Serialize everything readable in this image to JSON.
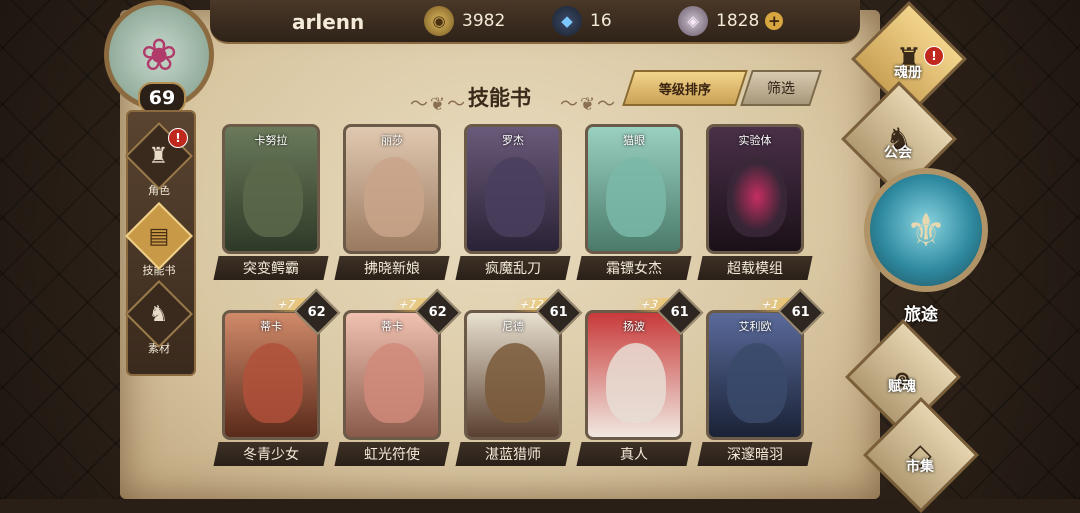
{
  "player": {
    "name": "arlenn",
    "level": "69"
  },
  "resources": [
    {
      "icon": "gold-coin-icon",
      "value": "3982"
    },
    {
      "icon": "blue-crystal-icon",
      "value": "16"
    },
    {
      "icon": "pink-diamond-icon",
      "value": "1828"
    }
  ],
  "header": {
    "title": "技能书",
    "sort_label": "等级排序",
    "filter_label": "筛选"
  },
  "left_nav": [
    {
      "label": "角色",
      "icon": "helmet-icon",
      "alert": "!"
    },
    {
      "label": "技能书",
      "icon": "book-icon"
    },
    {
      "label": "素材",
      "icon": "beast-icon"
    }
  ],
  "right_nav": {
    "soul_book": {
      "label": "魂册",
      "alert": "!"
    },
    "guild": {
      "label": "公会"
    },
    "journey": {
      "label": "旅途"
    },
    "talent": {
      "label": "赋魂"
    },
    "market": {
      "label": "市集"
    }
  },
  "cards_row1": [
    {
      "hero": "卡努拉",
      "skill": "突变鳄霸",
      "color": "#5a6a4a"
    },
    {
      "hero": "丽莎",
      "skill": "拂晓新娘",
      "color": "#c9a58a"
    },
    {
      "hero": "罗杰",
      "skill": "疯魔乱刀",
      "color": "#4a3e5e"
    },
    {
      "hero": "猫眼",
      "skill": "霜镖女杰",
      "color": "#7ab8a8"
    },
    {
      "hero": "实验体",
      "skill": "超载模组",
      "color": "#3a2838"
    }
  ],
  "cards_row2": [
    {
      "hero": "蒂卡",
      "skill": "冬青少女",
      "bonus": "+7",
      "level": "62",
      "color": "#b0503a"
    },
    {
      "hero": "蒂卡",
      "skill": "虹光符使",
      "bonus": "+7",
      "level": "62",
      "color": "#d08a7a"
    },
    {
      "hero": "尼德",
      "skill": "湛蓝猎师",
      "bonus": "+12",
      "level": "61",
      "color": "#7a5a3a"
    },
    {
      "hero": "扬波",
      "skill": "真人",
      "bonus": "+3",
      "level": "61",
      "color": "#c8b0a0"
    },
    {
      "hero": "艾利欧",
      "skill": "深邃暗羽",
      "bonus": "+1",
      "level": "61",
      "color": "#3a4a6a"
    }
  ]
}
